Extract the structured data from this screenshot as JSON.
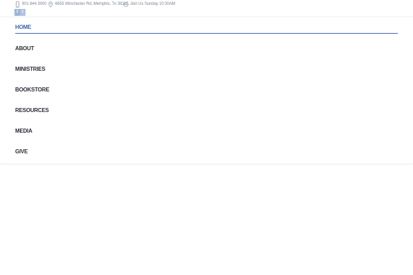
{
  "topbar": {
    "phone": "901 844 3000",
    "address": "6655 Winchester Rd, Memphis, Tn 38115",
    "hours": "Join Us Sunday 10:30AM"
  },
  "social": {
    "facebook_label": "f",
    "twitter_label": "t"
  },
  "nav": {
    "items": [
      {
        "label": "HOME",
        "active": true
      },
      {
        "label": "ABOUT"
      },
      {
        "label": "MINISTRIES"
      },
      {
        "label": "BOOKSTORE"
      },
      {
        "label": "RESOURCES"
      },
      {
        "label": "MEDIA"
      },
      {
        "label": "GIVE"
      }
    ]
  },
  "colors": {
    "accent": "#3b66a8",
    "nav_text": "#2a2f36",
    "info_text": "#7b8692"
  }
}
